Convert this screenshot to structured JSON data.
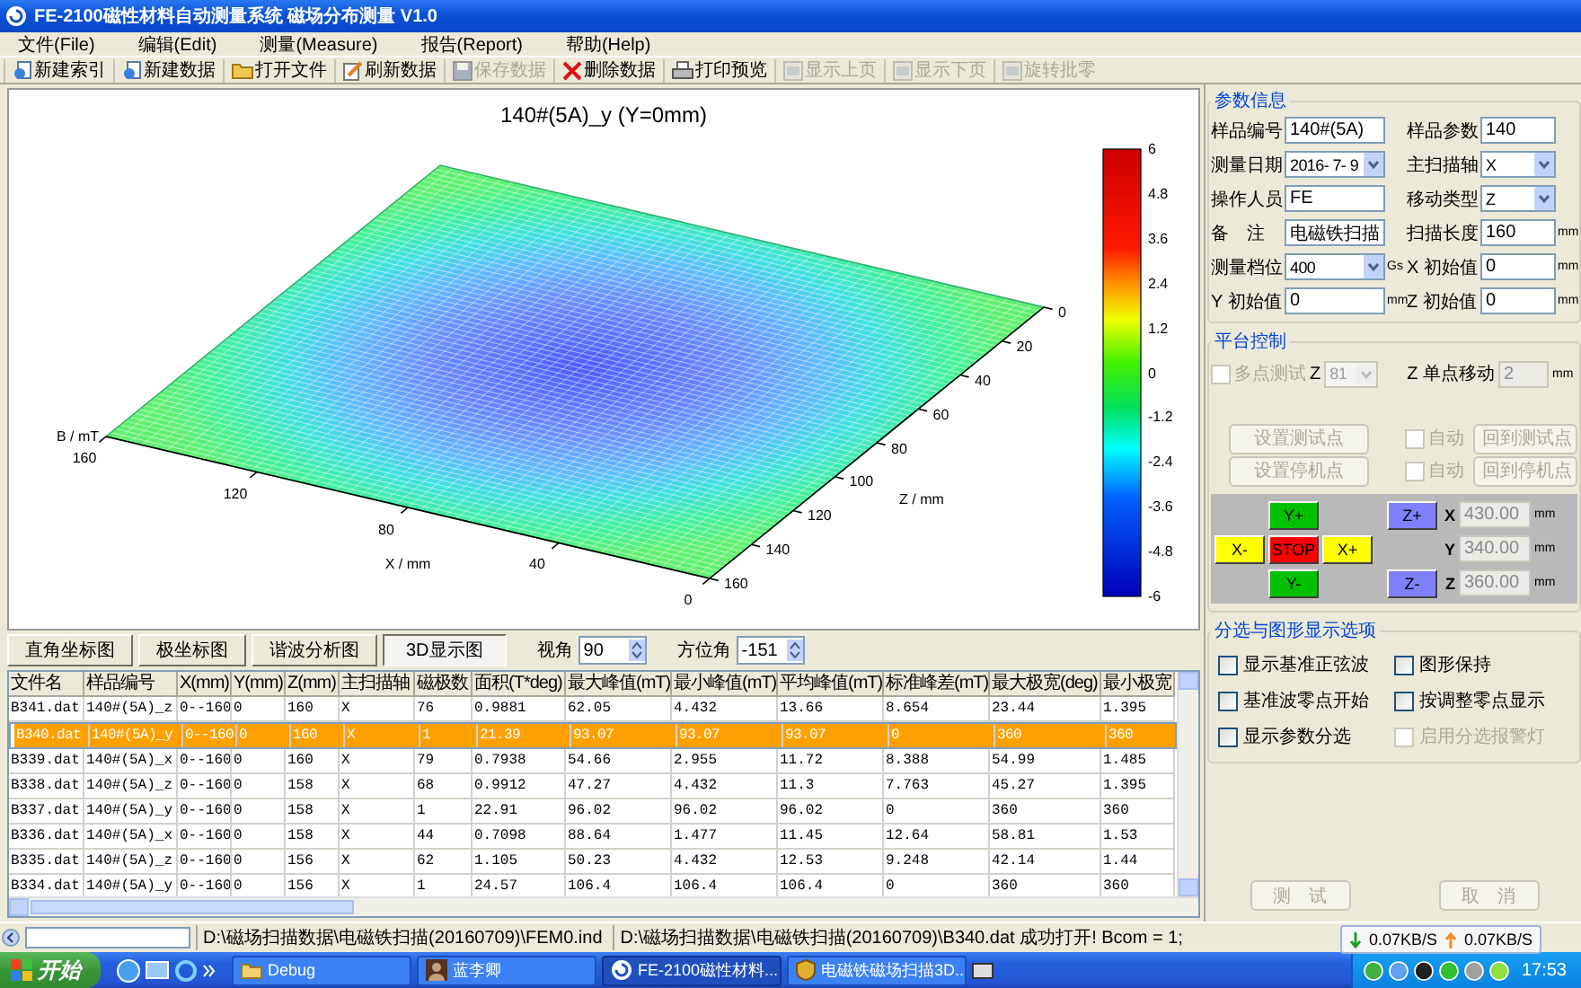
{
  "window": {
    "title": "FE-2100磁性材料自动测量系统 磁场分布测量 V1.0"
  },
  "menu": [
    {
      "label": "文件(File)"
    },
    {
      "label": "编辑(Edit)"
    },
    {
      "label": "测量(Measure)"
    },
    {
      "label": "报告(Report)"
    },
    {
      "label": "帮助(Help)"
    }
  ],
  "toolbar": [
    {
      "label": "新建索引",
      "kind": "document",
      "disabled": false
    },
    {
      "label": "新建数据",
      "kind": "document",
      "disabled": false
    },
    {
      "label": "打开文件",
      "kind": "folder",
      "disabled": false
    },
    {
      "label": "刷新数据",
      "kind": "notepad",
      "disabled": false
    },
    {
      "label": "保存数据",
      "kind": "floppy",
      "disabled": true
    },
    {
      "label": "删除数据",
      "kind": "cross",
      "disabled": false
    },
    {
      "label": "打印预览",
      "kind": "printer",
      "disabled": false
    },
    {
      "label": "显示上页",
      "kind": "page",
      "disabled": true
    },
    {
      "label": "显示下页",
      "kind": "page",
      "disabled": true
    },
    {
      "label": "旋转批零",
      "kind": "page",
      "disabled": true
    }
  ],
  "chart": {
    "title": "140#(5A)_y (Y=0mm)",
    "b_label": "B / mT",
    "x_label": "X / mm",
    "z_label": "Z / mm",
    "x_ticks": [
      "160",
      "120",
      "80",
      "40",
      "0"
    ],
    "z_ticks": [
      "160",
      "140",
      "120",
      "100",
      "80",
      "60",
      "40",
      "20",
      "0"
    ],
    "colorbar_ticks": [
      "6",
      "4.8",
      "3.6",
      "2.4",
      "1.2",
      "0",
      "-1.2",
      "-2.4",
      "-3.6",
      "-4.8",
      "-6"
    ]
  },
  "view_tabs": [
    {
      "label": "直角坐标图",
      "selected": false
    },
    {
      "label": "极坐标图",
      "selected": false
    },
    {
      "label": "谐波分析图",
      "selected": false
    },
    {
      "label": "3D显示图",
      "selected": true
    }
  ],
  "view_angle": {
    "label": "视角",
    "value": "90"
  },
  "azimuth": {
    "label": "方位角",
    "value": "-151"
  },
  "table": {
    "columns": [
      "文件名",
      "样品编号",
      "X(mm)",
      "Y(mm)",
      "Z(mm)",
      "主扫描轴",
      "磁极数",
      "面积(T*deg)",
      "最大峰值(mT)",
      "最小峰值(mT)",
      "平均峰值(mT)",
      "标准峰差(mT)",
      "最大极宽(deg)",
      "最小极宽"
    ],
    "rows": [
      {
        "selected": false,
        "cells": [
          "B341.dat",
          "140#(5A)_z",
          "0--160",
          "0",
          "160",
          "X",
          "76",
          "0.9881",
          "62.05",
          "4.432",
          "13.66",
          "8.654",
          "23.44",
          "1.395"
        ]
      },
      {
        "selected": true,
        "cells": [
          "B340.dat",
          "140#(5A)_y",
          "0--160",
          "0",
          "160",
          "X",
          "1",
          "21.39",
          "93.07",
          "93.07",
          "93.07",
          "0",
          "360",
          "360"
        ]
      },
      {
        "selected": false,
        "cells": [
          "B339.dat",
          "140#(5A)_x",
          "0--160",
          "0",
          "160",
          "X",
          "79",
          "0.7938",
          "54.66",
          "2.955",
          "11.72",
          "8.388",
          "54.99",
          "1.485"
        ]
      },
      {
        "selected": false,
        "cells": [
          "B338.dat",
          "140#(5A)_z",
          "0--160",
          "0",
          "158",
          "X",
          "68",
          "0.9912",
          "47.27",
          "4.432",
          "11.3",
          "7.763",
          "45.27",
          "1.395"
        ]
      },
      {
        "selected": false,
        "cells": [
          "B337.dat",
          "140#(5A)_y",
          "0--160",
          "0",
          "158",
          "X",
          "1",
          "22.91",
          "96.02",
          "96.02",
          "96.02",
          "0",
          "360",
          "360"
        ]
      },
      {
        "selected": false,
        "cells": [
          "B336.dat",
          "140#(5A)_x",
          "0--160",
          "0",
          "158",
          "X",
          "44",
          "0.7098",
          "88.64",
          "1.477",
          "11.45",
          "12.64",
          "58.81",
          "1.53"
        ]
      },
      {
        "selected": false,
        "cells": [
          "B335.dat",
          "140#(5A)_z",
          "0--160",
          "0",
          "156",
          "X",
          "62",
          "1.105",
          "50.23",
          "4.432",
          "12.53",
          "9.248",
          "42.14",
          "1.44"
        ]
      },
      {
        "selected": false,
        "cells": [
          "B334.dat",
          "140#(5A)_y",
          "0--160",
          "0",
          "156",
          "X",
          "1",
          "24.57",
          "106.4",
          "106.4",
          "106.4",
          "0",
          "360",
          "360"
        ]
      }
    ]
  },
  "params": {
    "title": "参数信息",
    "fields": [
      {
        "label": "样品编号",
        "value": "140#(5A)",
        "kind": "text"
      },
      {
        "label": "样品参数",
        "value": "140",
        "kind": "text"
      },
      {
        "label": "测量日期",
        "value": "2016- 7- 9",
        "kind": "select"
      },
      {
        "label": "主扫描轴",
        "value": "X",
        "kind": "select"
      },
      {
        "label": "操作人员",
        "value": "FE",
        "kind": "text"
      },
      {
        "label": "移动类型",
        "value": "Z",
        "kind": "select"
      },
      {
        "label": "备　注",
        "value": "电磁铁扫描",
        "kind": "text"
      },
      {
        "label": "扫描长度",
        "value": "160",
        "kind": "text",
        "unit": "mm"
      },
      {
        "label": "测量档位",
        "value": "400",
        "kind": "select",
        "unit": "Gs"
      },
      {
        "label": "X 初始值",
        "value": "0",
        "kind": "text",
        "unit": "mm"
      },
      {
        "label": "Y 初始值",
        "value": "0",
        "kind": "text",
        "unit": "mm"
      },
      {
        "label": "Z 初始值",
        "value": "0",
        "kind": "text",
        "unit": "mm"
      }
    ]
  },
  "platform": {
    "title": "平台控制",
    "multi": {
      "label": "多点测试",
      "checked": false,
      "disabled": true,
      "axis": "Z",
      "value": "81"
    },
    "single": {
      "label": "Z 单点移动",
      "value": "2",
      "unit": "mm",
      "disabled": true
    },
    "points": [
      {
        "set": "设置测试点",
        "auto": "自动",
        "checked": false,
        "back": "回到测试点",
        "disabled": true
      },
      {
        "set": "设置停机点",
        "auto": "自动",
        "checked": false,
        "back": "回到停机点",
        "disabled": true
      }
    ],
    "jog": [
      {
        "label": "Y+",
        "color": "#00c000"
      },
      {
        "label": "Z+",
        "color": "#8080ff"
      },
      {
        "label": "X-",
        "color": "#ffff00"
      },
      {
        "label": "STOP",
        "color": "#ff0000"
      },
      {
        "label": "X+",
        "color": "#ffff00"
      },
      {
        "label": "Y-",
        "color": "#00c000"
      },
      {
        "label": "Z-",
        "color": "#8080ff"
      }
    ],
    "coords": [
      {
        "axis": "X",
        "value": "430.00",
        "unit": "mm",
        "disabled": true
      },
      {
        "axis": "Y",
        "value": "340.00",
        "unit": "mm",
        "disabled": true
      },
      {
        "axis": "Z",
        "value": "360.00",
        "unit": "mm",
        "disabled": true
      }
    ]
  },
  "options": {
    "title": "分选与图形显示选项",
    "items": [
      {
        "label": "显示基准正弦波",
        "checked": false,
        "disabled": false
      },
      {
        "label": "图形保持",
        "checked": false,
        "disabled": false
      },
      {
        "label": "基准波零点开始",
        "checked": false,
        "disabled": false
      },
      {
        "label": "按调整零点显示",
        "checked": false,
        "disabled": false
      },
      {
        "label": "显示参数分选",
        "checked": false,
        "disabled": false
      },
      {
        "label": "启用分选报警灯",
        "checked": false,
        "disabled": true
      }
    ]
  },
  "actions": [
    {
      "label": "测　试",
      "disabled": true
    },
    {
      "label": "取　消",
      "disabled": true
    }
  ],
  "status_bar": {
    "path": "D:\\磁场扫描数据\\电磁铁扫描(20160709)\\FEM0.ind",
    "message": "D:\\磁场扫描数据\\电磁铁扫描(20160709)\\B340.dat 成功打开! Bcom = 1;",
    "down": "0.07KB/S",
    "up": "0.07KB/S"
  },
  "taskbar": {
    "start": "开始",
    "tasks": [
      {
        "label": "Debug",
        "kind": "folder",
        "selected": false
      },
      {
        "label": "蓝李卿",
        "kind": "person",
        "selected": false
      },
      {
        "label": "FE-2100磁性材料...",
        "kind": "app",
        "selected": true
      },
      {
        "label": "电磁铁磁场扫描3D...",
        "kind": "shield",
        "selected": false
      }
    ],
    "time": "17:53"
  }
}
